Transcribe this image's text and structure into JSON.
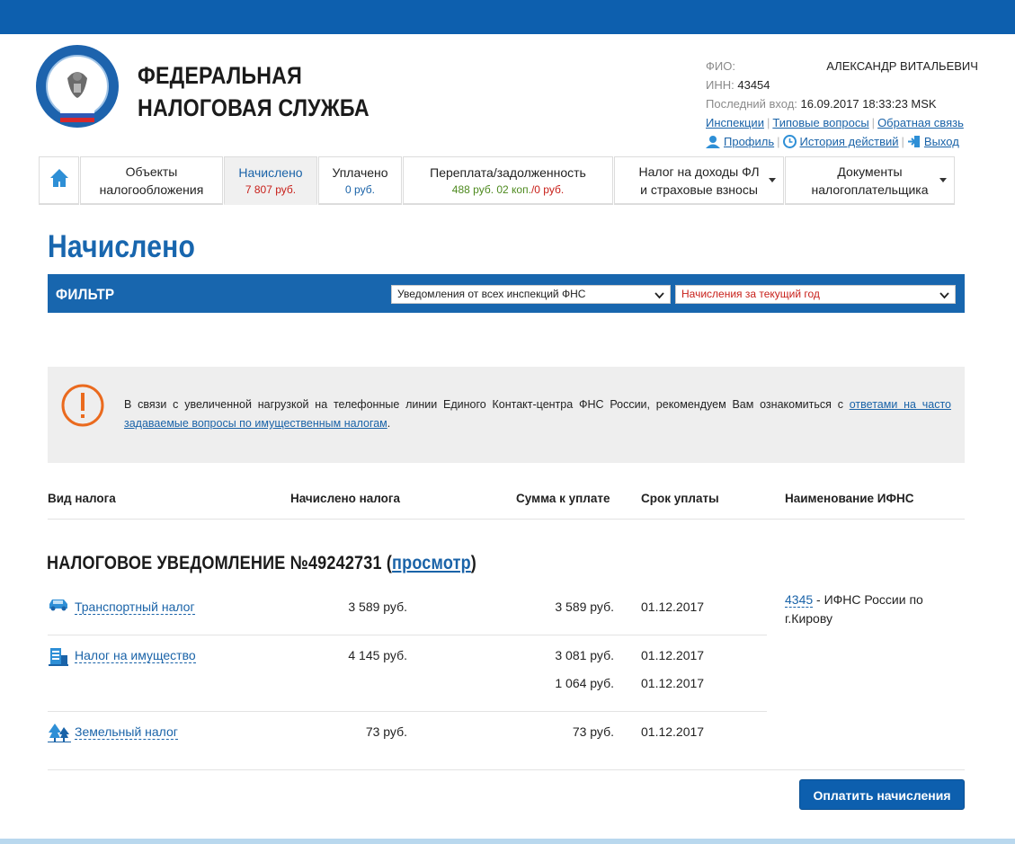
{
  "brand": {
    "line1": "ФЕДЕРАЛЬНАЯ",
    "line2": "НАЛОГОВАЯ СЛУЖБА"
  },
  "user": {
    "fio_label": "ФИО:",
    "fio_value": "АЛЕКСАНДР ВИТАЛЬЕВИЧ",
    "inn_label": "ИНН:",
    "inn_value": "43454",
    "last_login_label": "Последний вход:",
    "last_login_value": "16.09.2017 18:33:23 MSK",
    "links": [
      "Инспекции",
      "Типовые вопросы",
      "Обратная связь"
    ],
    "profile": "Профиль",
    "history": "История действий",
    "logout": "Выход"
  },
  "nav": {
    "tabs": [
      {
        "line1": "Объекты",
        "line2": "налогообложения"
      },
      {
        "label": "Начислено",
        "value": "7 807 руб."
      },
      {
        "label": "Уплачено",
        "value": "0 руб."
      },
      {
        "label": "Переплата/задолженность",
        "value_green": "488 руб. 02 коп.",
        "value_red": "/0 руб."
      },
      {
        "line1": "Налог на доходы ФЛ",
        "line2": "и страховые взносы"
      },
      {
        "line1": "Документы",
        "line2": "налогоплательщика"
      }
    ]
  },
  "page_title": "Начислено",
  "filter": {
    "label": "ФИЛЬТР",
    "inspections": "Уведомления от всех инспекций ФНС",
    "period": "Начисления за текущий год"
  },
  "notice": {
    "text": "В связи с увеличенной нагрузкой на телефонные линии Единого Контакт-центра ФНС России, рекомендуем Вам ознакомиться с ",
    "link": "ответами на часто задаваемые вопросы по имущественным налогам",
    "end": "."
  },
  "table": {
    "headers": [
      "Вид налога",
      "Начислено налога",
      "Сумма к уплате",
      "Срок уплаты",
      "Наименование ИФНС"
    ],
    "notice_title": "НАЛОГОВОЕ УВЕДОМЛЕНИЕ №49242731 (",
    "notice_link": "просмотр",
    "notice_close": ")",
    "rows": [
      {
        "name": "Транспортный налог",
        "accrued": "3 589 руб.",
        "due1": "3 589 руб.",
        "date1": "01.12.2017"
      },
      {
        "name": "Налог на имущество",
        "accrued": "4 145 руб.",
        "due1": "3 081 руб.",
        "date1": "01.12.2017",
        "due2": "1 064 руб.",
        "date2": "01.12.2017"
      },
      {
        "name": "Земельный налог",
        "accrued": "73 руб.",
        "due1": "73 руб.",
        "date1": "01.12.2017"
      }
    ],
    "ifns_code": "4345",
    "ifns_name": " - ИФНС России по г.Кирову"
  },
  "pay_button": "Оплатить начисления",
  "colors": {
    "brand_blue": "#0d5fae",
    "title_blue": "#1866ae",
    "link": "#1a63a8",
    "red": "#c8201a",
    "green": "#4e8a1f",
    "notice_orange": "#ea6a1e"
  }
}
